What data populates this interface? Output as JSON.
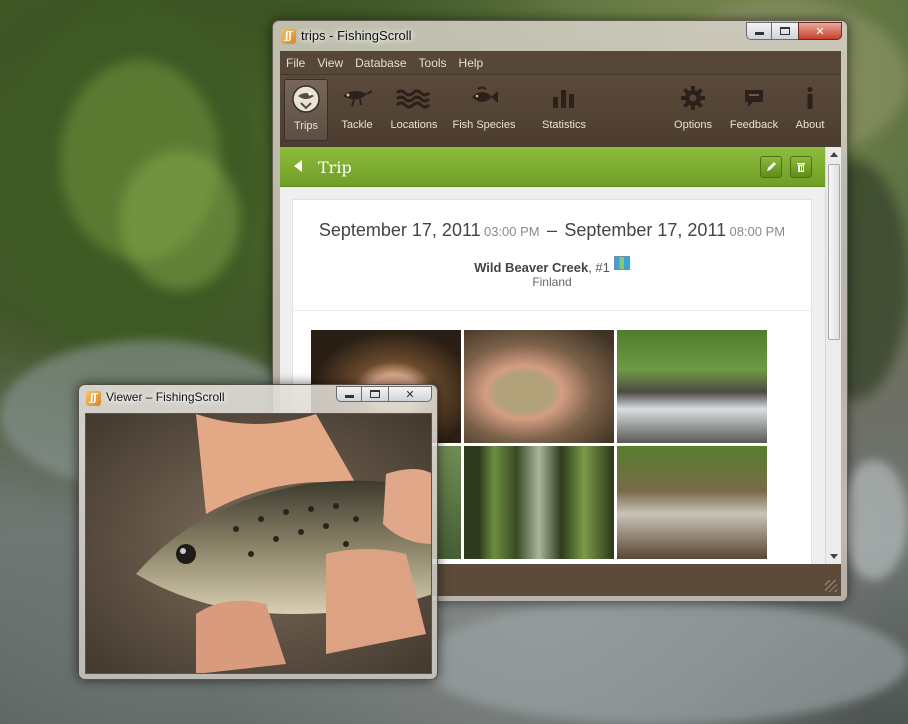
{
  "main_window": {
    "title": "trips - FishingScroll",
    "menu": [
      "File",
      "View",
      "Database",
      "Tools",
      "Help"
    ],
    "toolbar": [
      {
        "label": "Trips",
        "icon": "trips-icon",
        "active": true
      },
      {
        "label": "Tackle",
        "icon": "lure-icon"
      },
      {
        "label": "Locations",
        "icon": "waves-icon"
      },
      {
        "label": "Fish Species",
        "icon": "fish-icon"
      },
      {
        "label": "Statistics",
        "icon": "bar-chart-icon"
      },
      {
        "label": "Options",
        "icon": "gear-icon"
      },
      {
        "label": "Feedback",
        "icon": "speech-bubble-icon"
      },
      {
        "label": "About",
        "icon": "info-icon"
      }
    ],
    "panel": {
      "title": "Trip",
      "start_date": "September 17, 2011",
      "start_time": "03:00 PM",
      "separator": "–",
      "end_date": "September 17, 2011",
      "end_time": "08:00 PM",
      "location_name": "Wild Beaver Creek",
      "location_suffix": ", #1",
      "country": "Finland"
    }
  },
  "viewer_window": {
    "title": "Viewer – FishingScroll"
  },
  "colors": {
    "header_green": "#7fae2f",
    "toolbar_brown": "#54443a",
    "menubar_brown": "#574739"
  }
}
